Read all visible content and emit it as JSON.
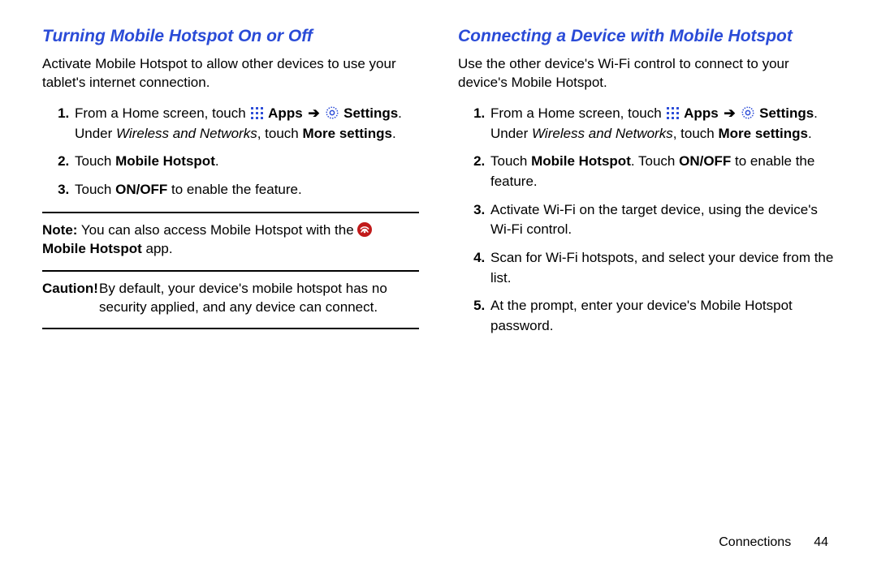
{
  "left": {
    "heading": "Turning Mobile Hotspot On or Off",
    "intro": "Activate Mobile Hotspot to allow other devices to use your tablet's internet connection.",
    "step1_pre": "From a Home screen, touch ",
    "apps": "Apps",
    "arrow": "➔",
    "settings": "Settings",
    "step1_post1": ". Under ",
    "wireless": "Wireless and Networks",
    "step1_post2": ", touch ",
    "more": "More settings",
    "step1_post3": ".",
    "step2_pre": "Touch ",
    "step2_bold": "Mobile Hotspot",
    "step2_post": ".",
    "step3_pre": "Touch ",
    "step3_bold": "ON/OFF",
    "step3_post": " to enable the feature.",
    "note_label": "Note:",
    "note_body": " You can also access Mobile Hotspot with the ",
    "note_bold": "Mobile Hotspot",
    "note_tail": " app.",
    "caution_label": "Caution!",
    "caution_body": "By default, your device's mobile hotspot has no security applied, and any device can connect."
  },
  "right": {
    "heading": "Connecting a Device with Mobile Hotspot",
    "intro": "Use the other device's Wi-Fi control to connect to your device's Mobile Hotspot.",
    "step1_pre": "From a Home screen, touch ",
    "apps": "Apps",
    "arrow": "➔",
    "settings": "Settings",
    "step1_post1": ". Under ",
    "wireless": "Wireless and Networks",
    "step1_post2": ", touch ",
    "more": "More settings",
    "step1_post3": ".",
    "step2_pre": "Touch ",
    "step2_bold": "Mobile Hotspot",
    "step2_mid": ". Touch ",
    "step2_bold2": "ON/OFF",
    "step2_post": " to enable the feature.",
    "step3": "Activate Wi-Fi on the target device, using the device's Wi-Fi control.",
    "step4": "Scan for Wi-Fi hotspots, and select your device from the list.",
    "step5": "At the prompt, enter your device's Mobile Hotspot password."
  },
  "footer": {
    "section": "Connections",
    "page": "44"
  }
}
